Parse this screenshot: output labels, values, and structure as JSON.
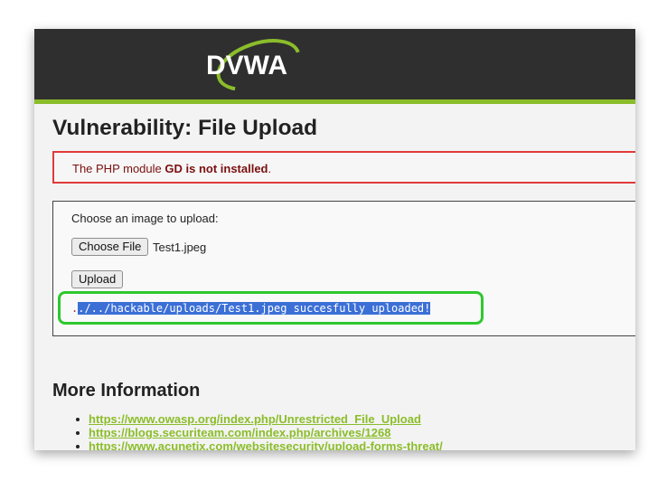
{
  "header": {
    "logo_text": "DVWA"
  },
  "page": {
    "title": "Vulnerability: File Upload"
  },
  "warning": {
    "prefix": "The PHP module ",
    "bold": "GD is not installed",
    "suffix": "."
  },
  "upload_form": {
    "prompt": "Choose an image to upload:",
    "choose_button": "Choose File",
    "file_name": "Test1.jpeg",
    "upload_button": "Upload"
  },
  "result": {
    "first_char": ".",
    "selected_text": "./../hackable/uploads/Test1.jpeg succesfully uploaded!"
  },
  "more_info": {
    "title": "More Information",
    "links": [
      "https://www.owasp.org/index.php/Unrestricted_File_Upload",
      "https://blogs.securiteam.com/index.php/archives/1268",
      "https://www.acunetix.com/websitesecurity/upload-forms-threat/"
    ]
  },
  "colors": {
    "header_bg": "#2f2f2f",
    "accent_green": "#8bbd2a",
    "warning_border": "#e03a3a",
    "highlight_green": "#2ec82e",
    "selection_blue": "#3b6fd6"
  }
}
